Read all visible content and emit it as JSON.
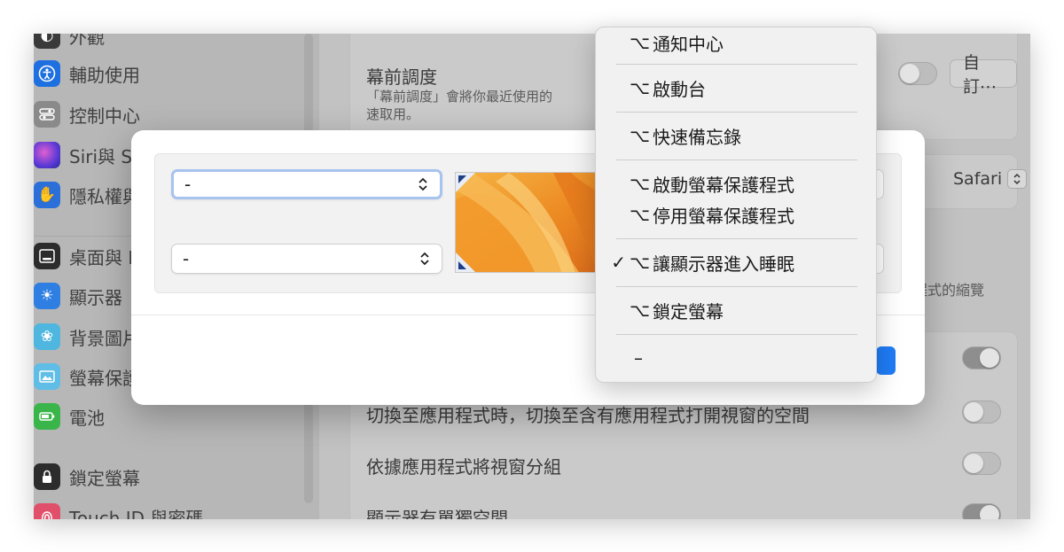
{
  "sidebar": {
    "items": [
      {
        "label": "外觀",
        "icon": "appearance-icon",
        "color": "#3a3a3a"
      },
      {
        "label": "輔助使用",
        "icon": "accessibility-icon",
        "color": "#1e6fe0"
      },
      {
        "label": "控制中心",
        "icon": "control-center-icon",
        "color": "#8a8a8a"
      },
      {
        "label": "Siri與 S",
        "icon": "siri-icon",
        "color": "#7b45d6"
      },
      {
        "label": "隱私權與",
        "icon": "privacy-hand-icon",
        "color": "#2b6fd8"
      },
      {
        "label": "桌面與 D",
        "icon": "desktop-dock-icon",
        "color": "#2c2c2c"
      },
      {
        "label": "顯示器",
        "icon": "display-sun-icon",
        "color": "#2f7fe3"
      },
      {
        "label": "背景圖片",
        "icon": "wallpaper-flower-icon",
        "color": "#4fb6e0"
      },
      {
        "label": "螢幕保護",
        "icon": "screensaver-icon",
        "color": "#5fbde6"
      },
      {
        "label": "電池",
        "icon": "battery-icon",
        "color": "#3ab54a"
      },
      {
        "label": "鎖定螢幕",
        "icon": "lock-screen-icon",
        "color": "#2c2c2c"
      },
      {
        "label": "Touch ID 與密碼",
        "icon": "touch-id-icon",
        "color": "#e0506a"
      }
    ]
  },
  "content": {
    "stage_manager": {
      "title": "幕前調度",
      "desc_line1": "「幕前調度」會將你最近使用的",
      "desc_line2": "速取用。",
      "custom_button": "自訂⋯"
    },
    "browser_value": "Safari",
    "side_note": "程式的縮覽",
    "rows": [
      {
        "label": "切換至應用程式時，切換至含有應用程式打開視窗的空間",
        "on": false
      },
      {
        "label": "依據應用程式將視窗分組",
        "on": false
      },
      {
        "label": "顯示器有單獨空間",
        "on": true
      }
    ],
    "first_toggle_on": true
  },
  "dialog": {
    "top_left_value": "-",
    "bottom_left_value": "-"
  },
  "menu": {
    "items": [
      {
        "label": "通知中心",
        "option": true,
        "checked": false
      },
      {
        "label": "啟動台",
        "option": true,
        "checked": false
      },
      {
        "label": "快速備忘錄",
        "option": true,
        "checked": false
      },
      {
        "label": "啟動螢幕保護程式",
        "option": true,
        "checked": false
      },
      {
        "label": "停用螢幕保護程式",
        "option": true,
        "checked": false
      },
      {
        "label": "讓顯示器進入睡眠",
        "option": true,
        "checked": true
      },
      {
        "label": "鎖定螢幕",
        "option": true,
        "checked": false
      },
      {
        "label": "–",
        "option": false,
        "checked": false
      }
    ],
    "option_glyph": "⌥",
    "check_glyph": "✓"
  }
}
